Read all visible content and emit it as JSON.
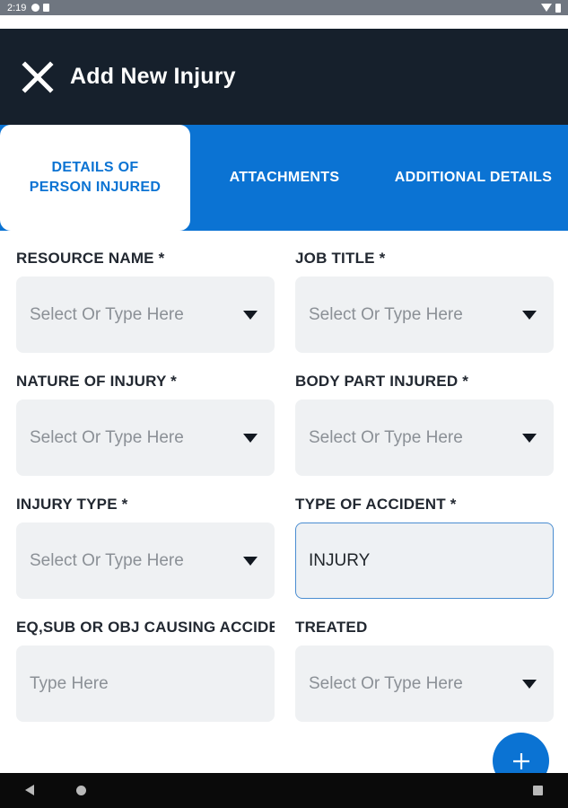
{
  "status_bar": {
    "time": "2:19"
  },
  "app_bar": {
    "title": "Add New Injury"
  },
  "tabs": [
    {
      "label": "DETAILS OF PERSON INJURED",
      "active": true
    },
    {
      "label": "ATTACHMENTS",
      "active": false
    },
    {
      "label": "ADDITIONAL DETAILS",
      "active": false
    }
  ],
  "form": {
    "resource_name": {
      "label": "RESOURCE NAME *",
      "placeholder": "Select Or Type Here"
    },
    "job_title": {
      "label": "JOB TITLE *",
      "placeholder": "Select Or Type Here"
    },
    "nature_of_injury": {
      "label": "NATURE OF INJURY *",
      "placeholder": "Select Or Type Here"
    },
    "body_part_injured": {
      "label": "BODY PART INJURED *",
      "placeholder": "Select Or Type Here"
    },
    "injury_type": {
      "label": "INJURY TYPE *",
      "placeholder": "Select Or Type Here"
    },
    "type_of_accident": {
      "label": "TYPE OF ACCIDENT *",
      "value": "INJURY"
    },
    "eq_sub_obj": {
      "label": "EQ,SUB OR OBJ CAUSING ACCIDEN..",
      "placeholder": "Type Here"
    },
    "treated": {
      "label": "TREATED",
      "placeholder": "Select Or Type Here"
    }
  },
  "colors": {
    "app_bar": "#16202c",
    "accent": "#0b73d3",
    "input_bg": "#eff1f3",
    "focus_border": "#4a8dd1"
  },
  "icons": {
    "close": "close-icon",
    "dropdown": "chevron-down-icon",
    "fab": "plus-icon"
  }
}
